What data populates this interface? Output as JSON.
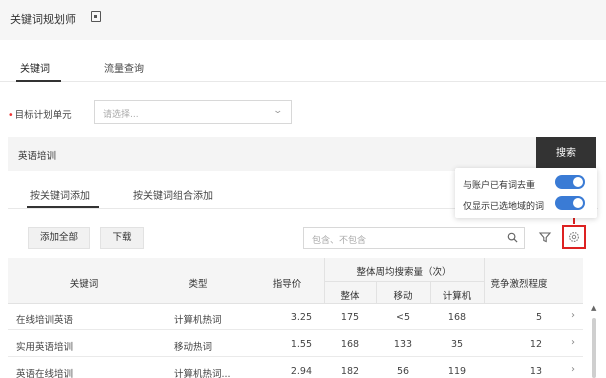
{
  "header": {
    "title": "关键词规划师",
    "title_icon": "save-icon"
  },
  "tabs": [
    {
      "label": "关键词",
      "active": true
    },
    {
      "label": "流量查询",
      "active": false
    }
  ],
  "plan": {
    "label": "目标计划单元",
    "required_mark": "•",
    "placeholder": "请选择..."
  },
  "search": {
    "value": "英语培训",
    "button_label": "搜索"
  },
  "subtabs": [
    {
      "label": "按关键词添加",
      "active": true
    },
    {
      "label": "按关键词组合添加",
      "active": false
    }
  ],
  "toolbar": {
    "add_all_label": "添加全部",
    "download_label": "下载",
    "filter_placeholder": "包含、不包含"
  },
  "popover": {
    "items": [
      {
        "label": "与账户已有词去重",
        "enabled": true
      },
      {
        "label": "仅显示已选地域的词",
        "enabled": true
      }
    ]
  },
  "table": {
    "headers": {
      "keyword": "关键词",
      "type": "类型",
      "guide_price": "指导价",
      "weekly_group": "整体周均搜索量（次）",
      "overall": "整体",
      "mobile": "移动",
      "computer": "计算机",
      "competition": "竞争激烈程度"
    },
    "rows": [
      {
        "keyword": "在线培训英语",
        "type": "计算机热词",
        "price": "3.25",
        "overall": "175",
        "mobile": "<5",
        "computer": "168",
        "competition": "5"
      },
      {
        "keyword": "实用英语培训",
        "type": "移动热词",
        "price": "1.55",
        "overall": "168",
        "mobile": "133",
        "computer": "35",
        "competition": "12"
      },
      {
        "keyword": "英语在线培训",
        "type": "计算机热词...",
        "price": "2.94",
        "overall": "182",
        "mobile": "56",
        "computer": "119",
        "competition": "13"
      }
    ]
  },
  "colors": {
    "accent": "#3a7bd5",
    "highlight": "#d22222",
    "search_button": "#333333"
  }
}
